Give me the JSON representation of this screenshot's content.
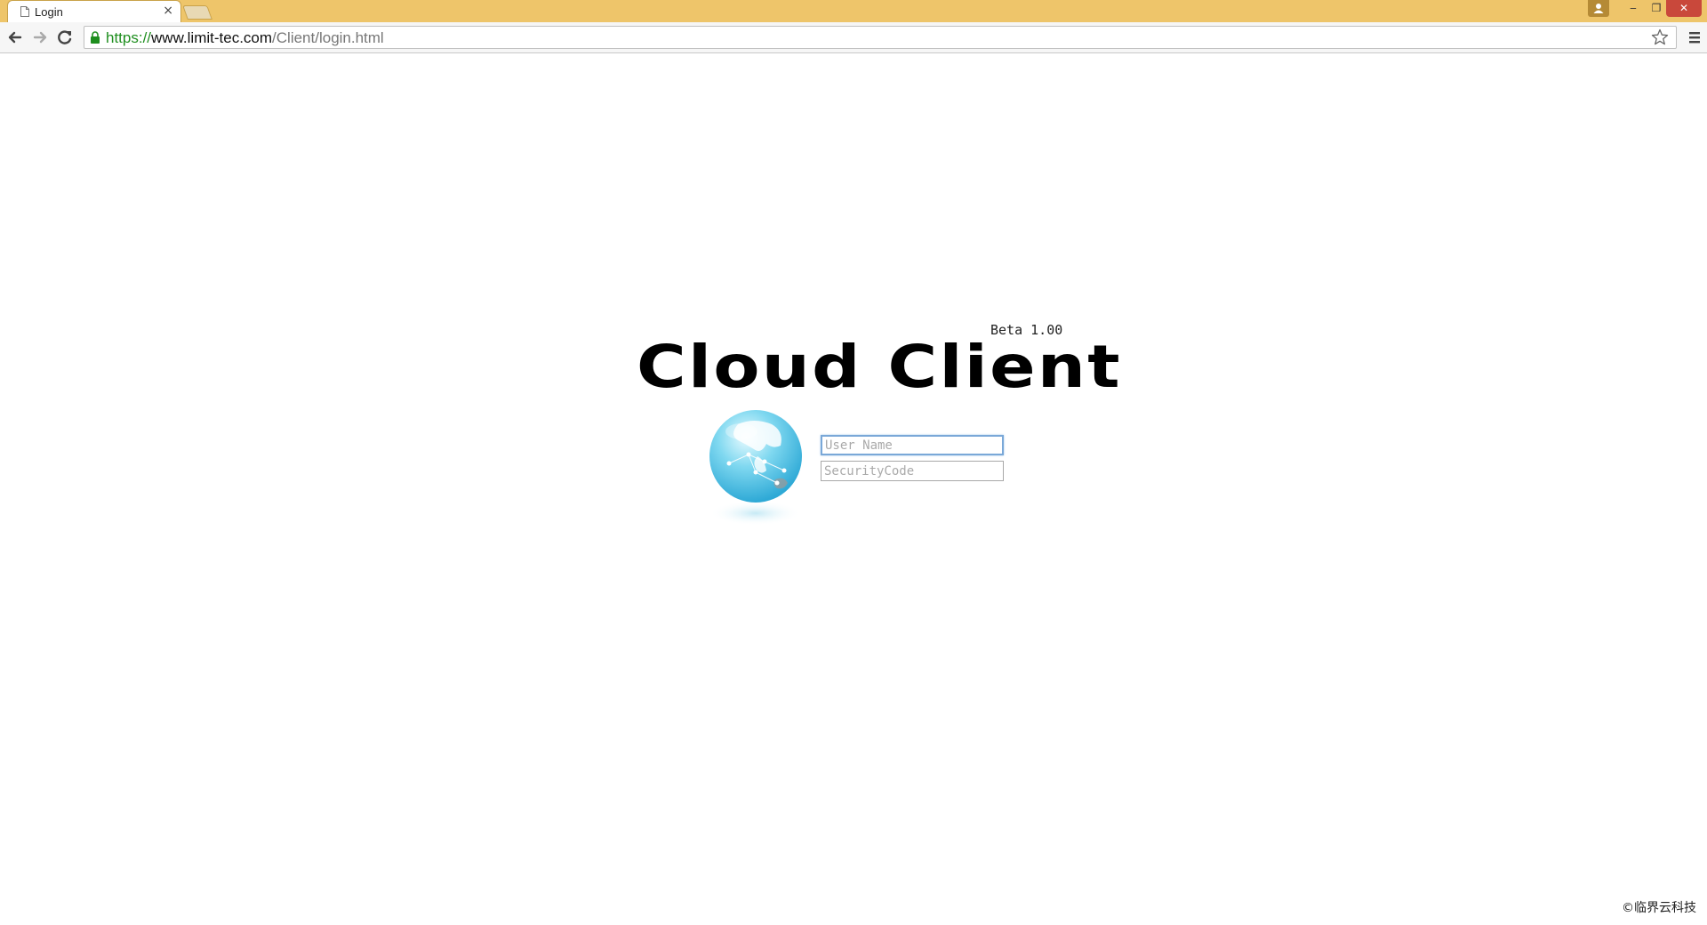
{
  "browser": {
    "tab_title": "Login",
    "tab_close": "×",
    "url_scheme": "https://",
    "url_host": "www.limit-tec.com",
    "url_path": "/Client/login.html",
    "window_min": "‒",
    "window_max": "❐",
    "window_close": "✕"
  },
  "login": {
    "title": "Cloud Client",
    "version": "Beta 1.00",
    "username_placeholder": "User Name",
    "security_placeholder": "SecurityCode"
  },
  "footer": {
    "copyright": "©临界云科技"
  },
  "colors": {
    "titlebar": "#eec56a",
    "close_button": "#c9483b",
    "url_scheme": "#1e8e1e",
    "globe_blue": "#4cc3e6",
    "input_focus_border": "#7aa8d8"
  }
}
